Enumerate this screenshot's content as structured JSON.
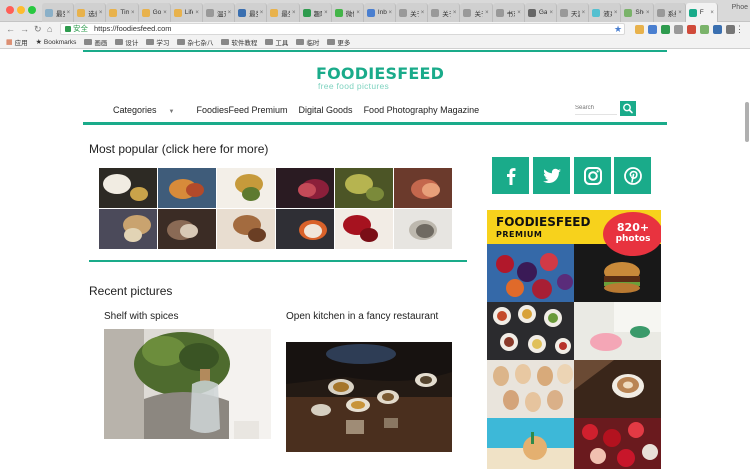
{
  "browser": {
    "tabs": [
      {
        "title": "最受",
        "favicon": "#8ab0c8"
      },
      {
        "title": "选秀",
        "favicon": "#e8b24c"
      },
      {
        "title": "Tim",
        "favicon": "#e8b24c"
      },
      {
        "title": "Gou",
        "favicon": "#e8b24c"
      },
      {
        "title": "Life",
        "favicon": "#e8b24c"
      },
      {
        "title": "温齐",
        "favicon": "#999999"
      },
      {
        "title": "最受",
        "favicon": "#3a6fb0"
      },
      {
        "title": "最受",
        "favicon": "#e8b24c"
      },
      {
        "title": "趣歌",
        "favicon": "#2e9b4e"
      },
      {
        "title": "微信",
        "favicon": "#44b549"
      },
      {
        "title": "Inbo",
        "favicon": "#4a7fd0"
      },
      {
        "title": "关于",
        "favicon": "#999999"
      },
      {
        "title": "关于",
        "favicon": "#999999"
      },
      {
        "title": "关于",
        "favicon": "#999999"
      },
      {
        "title": "书东",
        "favicon": "#999999"
      },
      {
        "title": "Galt",
        "favicon": "#666666"
      },
      {
        "title": "天涯",
        "favicon": "#999999"
      },
      {
        "title": "液系",
        "favicon": "#54c0d0"
      },
      {
        "title": "Sho",
        "favicon": "#7ab36a"
      },
      {
        "title": "系统",
        "favicon": "#999999"
      },
      {
        "title": "F",
        "favicon": "#1aab8a",
        "active": true
      }
    ],
    "profile_label": "Phoe",
    "secure_label": "安全",
    "url": "https://foodiesfeed.com",
    "bookmarks": [
      {
        "label": "应用",
        "icon": "apps-icon"
      },
      {
        "label": "Bookmarks",
        "icon": "star-icon"
      },
      {
        "label": "画画",
        "icon": "folder-icon"
      },
      {
        "label": "设计",
        "icon": "folder-icon"
      },
      {
        "label": "学习",
        "icon": "folder-icon"
      },
      {
        "label": "杂七杂八",
        "icon": "folder-icon"
      },
      {
        "label": "软件教程",
        "icon": "folder-icon"
      },
      {
        "label": "工具",
        "icon": "folder-icon"
      },
      {
        "label": "临时",
        "icon": "folder-icon"
      },
      {
        "label": "更多",
        "icon": "folder-icon"
      }
    ]
  },
  "site": {
    "logo": "FOODIESFEED",
    "tagline": "free food pictures",
    "nav": [
      "Categories",
      "FoodiesFeed Premium",
      "Digital Goods",
      "Food Photography Magazine"
    ],
    "search_placeholder": "Search",
    "accent": "#1aab8a"
  },
  "popular": {
    "heading": "Most popular (click here for more)",
    "thumbs": [
      {
        "name": "thumb-pasta-plate",
        "colors": [
          "#2d2a24",
          "#f1ece2",
          "#c9a34a"
        ]
      },
      {
        "name": "thumb-toast-board",
        "colors": [
          "#3f5c7a",
          "#d78b3a",
          "#b24a2a"
        ]
      },
      {
        "name": "thumb-pineapple",
        "colors": [
          "#f3efe8",
          "#c69a3b",
          "#5d7a2f"
        ]
      },
      {
        "name": "thumb-berries-dark",
        "colors": [
          "#2a1b22",
          "#8b1f3a",
          "#c44a58"
        ]
      },
      {
        "name": "thumb-limes-greens",
        "colors": [
          "#4c5526",
          "#b6b450",
          "#7b8a3a"
        ]
      },
      {
        "name": "thumb-shellfish",
        "colors": [
          "#6b3a2c",
          "#c4674d",
          "#e8a07a"
        ]
      },
      {
        "name": "thumb-table-spread",
        "colors": [
          "#4b4a5a",
          "#c9a36f",
          "#e2d4b5"
        ]
      },
      {
        "name": "thumb-coffee-table",
        "colors": [
          "#3b2c25",
          "#8a6a55",
          "#d8c9b6"
        ]
      },
      {
        "name": "thumb-latte",
        "colors": [
          "#e8ddd0",
          "#a36b3f",
          "#6a3e24"
        ]
      },
      {
        "name": "thumb-fruit-slate",
        "colors": [
          "#2f2f35",
          "#d9622a",
          "#f0e6da"
        ]
      },
      {
        "name": "thumb-cherries-bowl",
        "colors": [
          "#f2ece5",
          "#a6121f",
          "#7a0e16"
        ]
      },
      {
        "name": "thumb-notebook",
        "colors": [
          "#e7e5e1",
          "#bdb8ae",
          "#6f6a62"
        ]
      }
    ]
  },
  "recent": {
    "heading": "Recent pictures",
    "cards": [
      {
        "title": "Shelf with spices"
      },
      {
        "title": "Open kitchen in a fancy restaurant"
      }
    ]
  },
  "sidebar": {
    "social": [
      {
        "name": "facebook-icon"
      },
      {
        "name": "twitter-icon"
      },
      {
        "name": "instagram-icon"
      },
      {
        "name": "pinterest-icon"
      }
    ],
    "premium": {
      "title": "FOODIESFEED",
      "subtitle": "PREMIUM",
      "badge_count": "820+",
      "badge_label": "photos"
    }
  }
}
